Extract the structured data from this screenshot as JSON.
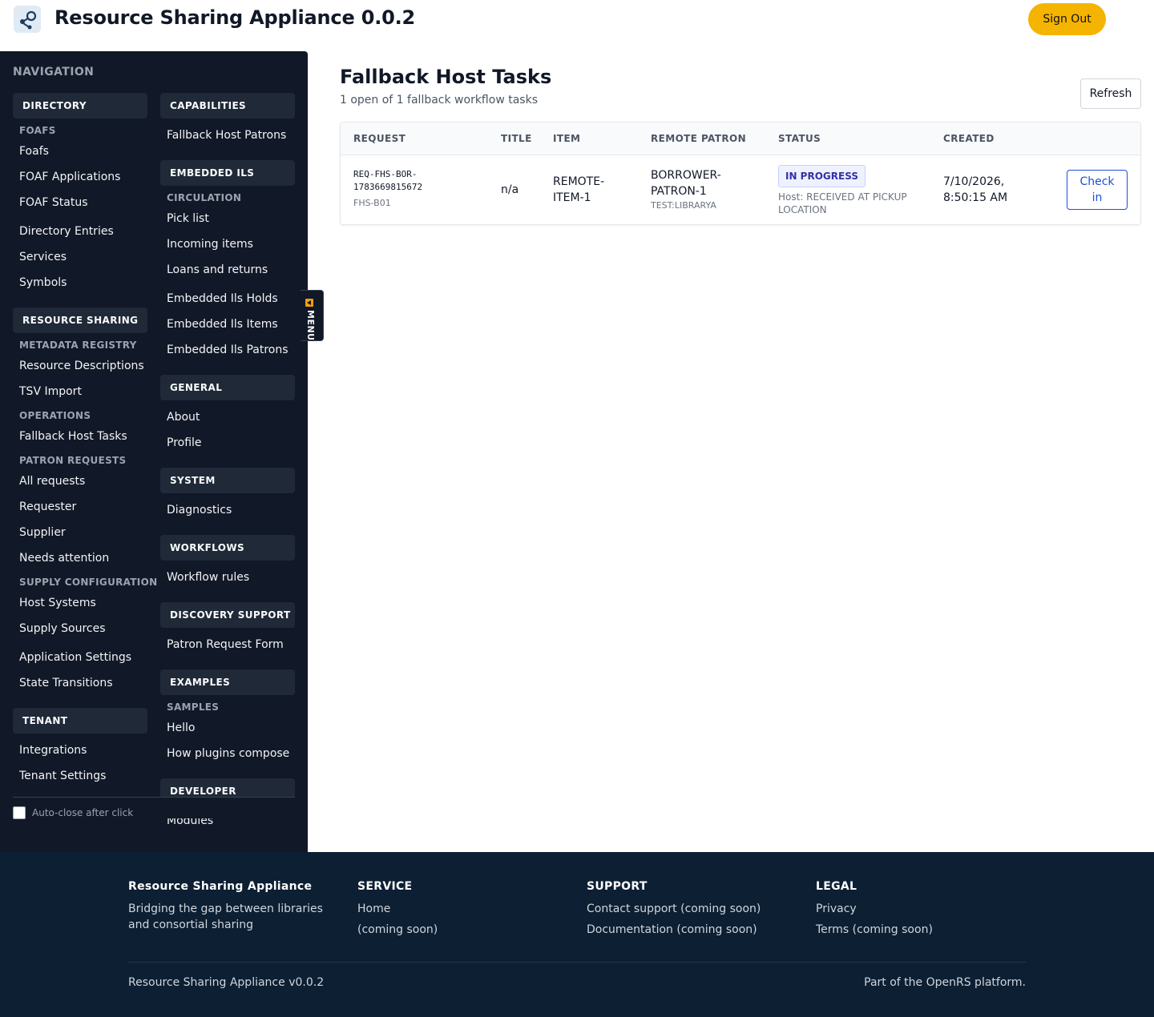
{
  "header": {
    "app_title": "Resource Sharing Appliance 0.0.2",
    "sign_out_label": "Sign Out",
    "logo_icon": "share-nodes-icon"
  },
  "sidebar": {
    "heading": "NAVIGATION",
    "left": {
      "directory": {
        "title": "DIRECTORY",
        "foafs_sub": "FOAFS",
        "foafs": "Foafs",
        "foaf_applications": "FOAF Applications",
        "foaf_status": "FOAF Status",
        "directory_entries": "Directory Entries",
        "services": "Services",
        "symbols": "Symbols"
      },
      "resource_sharing": {
        "title": "RESOURCE SHARING",
        "metadata_registry": "METADATA REGISTRY",
        "resource_descriptions": "Resource Descriptions",
        "tsv_import": "TSV Import",
        "operations": "OPERATIONS",
        "fallback_host_tasks": "Fallback Host Tasks",
        "patron_requests": "PATRON REQUESTS",
        "all_requests": "All requests",
        "requester": "Requester",
        "supplier": "Supplier",
        "needs_attention": "Needs attention",
        "supply_configuration": "SUPPLY CONFIGURATION",
        "host_systems": "Host Systems",
        "supply_sources": "Supply Sources",
        "application_settings": "Application Settings",
        "state_transitions": "State Transitions"
      },
      "tenant": {
        "title": "TENANT",
        "integrations": "Integrations",
        "tenant_settings": "Tenant Settings"
      }
    },
    "right": {
      "capabilities": {
        "title": "CAPABILITIES",
        "fallback_host_patrons": "Fallback Host Patrons"
      },
      "embedded_ils": {
        "title": "EMBEDDED ILS",
        "circulation": "CIRCULATION",
        "pick_list": "Pick list",
        "incoming_items": "Incoming items",
        "loans_and_returns": "Loans and returns",
        "holds": "Embedded Ils Holds",
        "items": "Embedded Ils Items",
        "patrons": "Embedded Ils Patrons"
      },
      "general": {
        "title": "GENERAL",
        "about": "About",
        "profile": "Profile"
      },
      "system": {
        "title": "SYSTEM",
        "diagnostics": "Diagnostics"
      },
      "workflows": {
        "title": "WORKFLOWS",
        "workflow_rules": "Workflow rules"
      },
      "discovery_support": {
        "title": "DISCOVERY SUPPORT",
        "patron_request_form": "Patron Request Form"
      },
      "examples": {
        "title": "EXAMPLES",
        "samples": "SAMPLES",
        "hello": "Hello",
        "how_plugins_compose": "How plugins compose"
      },
      "developer": {
        "title": "DEVELOPER",
        "modules": "Modules"
      }
    },
    "auto_close_label": "Auto-close after click",
    "auto_close_checked": false,
    "menu_toggle_label": "MENU"
  },
  "main": {
    "title": "Fallback Host Tasks",
    "subtitle": "1 open of 1 fallback workflow tasks",
    "refresh_label": "Refresh",
    "columns": [
      "REQUEST",
      "TITLE",
      "ITEM",
      "REMOTE PATRON",
      "STATUS",
      "CREATED"
    ],
    "rows": [
      {
        "request_id_line1": "REQ-FHS-BOR-",
        "request_id_line2": "1783669815672",
        "request_code": "FHS-B01",
        "title": "n/a",
        "item_line1": "REMOTE-",
        "item_line2": "ITEM-1",
        "patron_line1": "BORROWER-",
        "patron_line2": "PATRON-1",
        "patron_agency": "TEST:LIBRARYA",
        "status": "IN PROGRESS",
        "host_status_line1": "Host: RECEIVED AT PICKUP",
        "host_status_line2": "LOCATION",
        "created_line1": "7/10/2026,",
        "created_line2": "8:50:15 AM",
        "action_line1": "Check",
        "action_line2": "in"
      }
    ]
  },
  "footer": {
    "brand": "Resource Sharing Appliance",
    "tagline": "Bridging the gap between libraries and consortial sharing",
    "service_heading": "SERVICE",
    "service_links": [
      "Home",
      "(coming soon)"
    ],
    "support_heading": "SUPPORT",
    "support_links": [
      "Contact support (coming soon)",
      "Documentation (coming soon)"
    ],
    "legal_heading": "LEGAL",
    "legal_links": [
      "Privacy",
      "Terms (coming soon)"
    ],
    "version": "Resource Sharing Appliance v0.0.2",
    "platform": "Part of the OpenRS platform."
  },
  "colors": {
    "accent": "#f5b400",
    "sidebar_bg": "#111827",
    "footer_bg": "#0c1f33",
    "status_badge": "#3730a3",
    "link": "#1d4ed8"
  }
}
